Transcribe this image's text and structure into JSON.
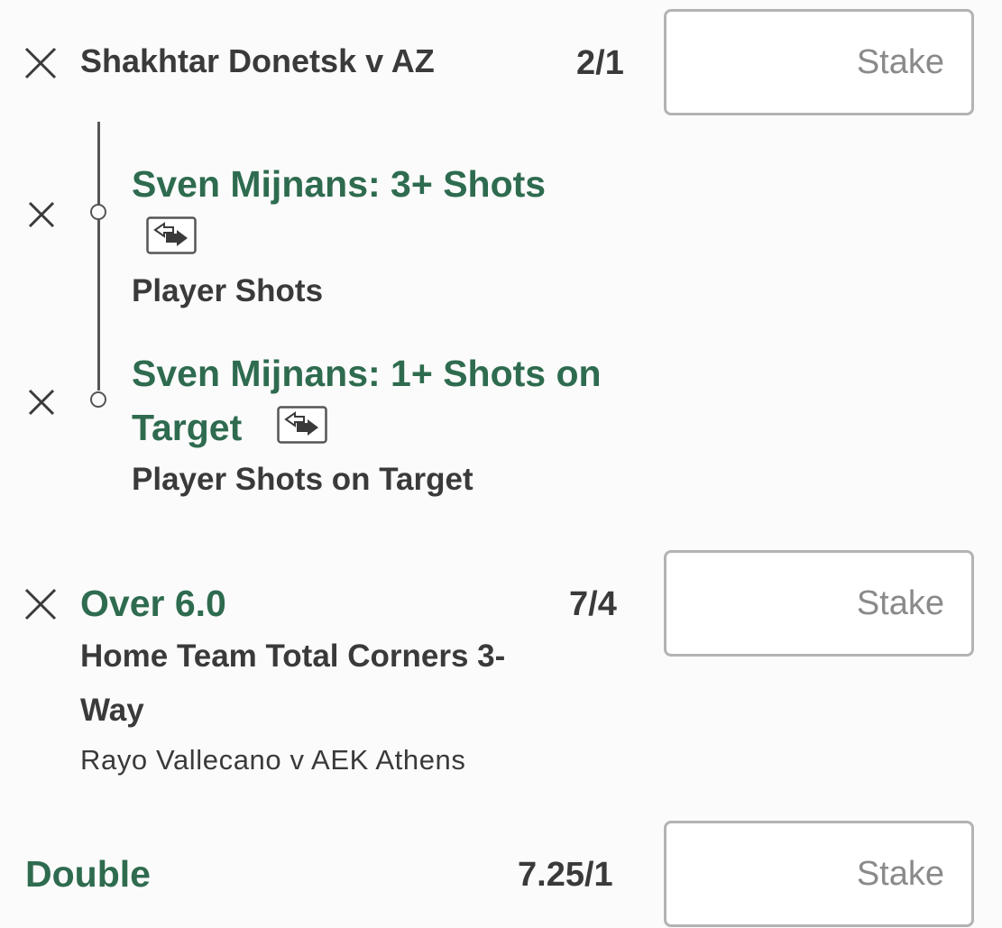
{
  "bets": [
    {
      "match": "Shakhtar Donetsk v AZ",
      "odds": "2/1",
      "stake_placeholder": "Stake",
      "legs": [
        {
          "selection": "Sven Mijnans: 3+ Shots",
          "market": "Player Shots"
        },
        {
          "selection_line1": "Sven Mijnans: 1+ Shots on",
          "selection_line2": "Target",
          "market": "Player Shots on Target"
        }
      ]
    },
    {
      "selection": "Over 6.0",
      "odds": "7/4",
      "market_line1": "Home Team Total Corners 3-",
      "market_line2": "Way",
      "event": "Rayo Vallecano v AEK Athens",
      "stake_placeholder": "Stake"
    }
  ],
  "double": {
    "label": "Double",
    "odds": "7.25/1",
    "stake_placeholder": "Stake"
  },
  "colors": {
    "accent_green": "#2e6b4f",
    "text_dark": "#3a3a3a",
    "border_grey": "#b3b3b3",
    "placeholder_grey": "#8a8a8a"
  },
  "icons": [
    "close-icon",
    "swap-icon"
  ]
}
